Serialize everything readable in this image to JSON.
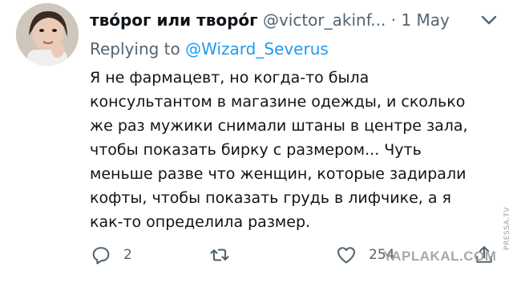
{
  "tweet": {
    "display_name": "тво́рог или творо́г",
    "handle": "@victor_akinf...",
    "separator": "·",
    "date": "1 May",
    "reply_prefix": "Replying to ",
    "reply_to": "@Wizard_Severus",
    "text_lines": [
      "Я не фармацевт, но когда-то была",
      "консультантом в магазине одежды, и сколько",
      "же раз мужики снимали штаны в центре зала,",
      "чтобы показать бирку с размером... Чуть",
      "меньше разве что женщин, которые задирали",
      "кофты, чтобы показать грудь в лифчике, а я",
      "как-то определила размер."
    ],
    "reply_count": "2",
    "retweet_count": "",
    "like_count": "254"
  },
  "icons": {
    "more": "more-icon",
    "reply": "reply-icon",
    "retweet": "retweet-icon",
    "like": "heart-icon",
    "share": "share-icon"
  },
  "watermark": "YAPLAKAL.COM",
  "side_watermark": "PRESSA.TV",
  "colors": {
    "text": "#0f1419",
    "secondary": "#536471",
    "link": "#1d9bf0"
  }
}
